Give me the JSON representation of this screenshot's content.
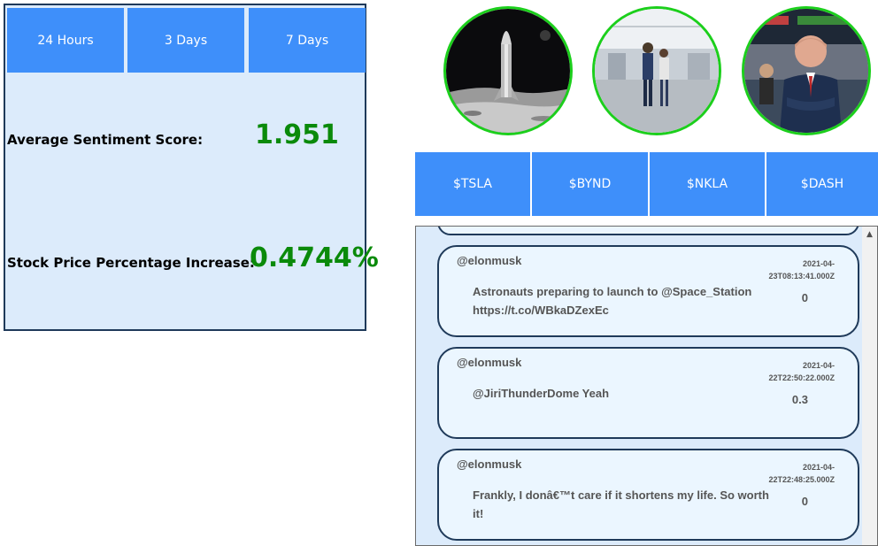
{
  "time_ranges": [
    "24 Hours",
    "3 Days",
    "7 Days"
  ],
  "metrics": {
    "sentiment_label": "Average Sentiment Score:",
    "sentiment_value": "1.951",
    "price_label": "Stock Price Percentage Increase:",
    "price_value": "0.4744%"
  },
  "avatars": [
    {
      "subject": "starship-on-moon"
    },
    {
      "subject": "couple-in-hangar"
    },
    {
      "subject": "man-on-trading-floor"
    }
  ],
  "tickers": [
    "$TSLA",
    "$BYND",
    "$NKLA",
    "$DASH"
  ],
  "tweets": [
    {
      "user": "@elonmusk",
      "time": "2021-04-23T08:13:41.000Z",
      "text": "Astronauts preparing to launch to @Space_Station https://t.co/WBkaDZexEc",
      "score": "0"
    },
    {
      "user": "@elonmusk",
      "time": "2021-04-22T22:50:22.000Z",
      "text": "@JiriThunderDome Yeah",
      "score": "0.3"
    },
    {
      "user": "@elonmusk",
      "time": "2021-04-22T22:48:25.000Z",
      "text": "Frankly, I donâ€™t care if it shortens my life. So worth it!",
      "score": "0"
    }
  ],
  "colors": {
    "accent": "#3e8ffa",
    "panel_bg": "#dcebfb",
    "positive": "#0a8a0a",
    "avatar_ring": "#1ccf1c",
    "border": "#1f3a5a"
  }
}
